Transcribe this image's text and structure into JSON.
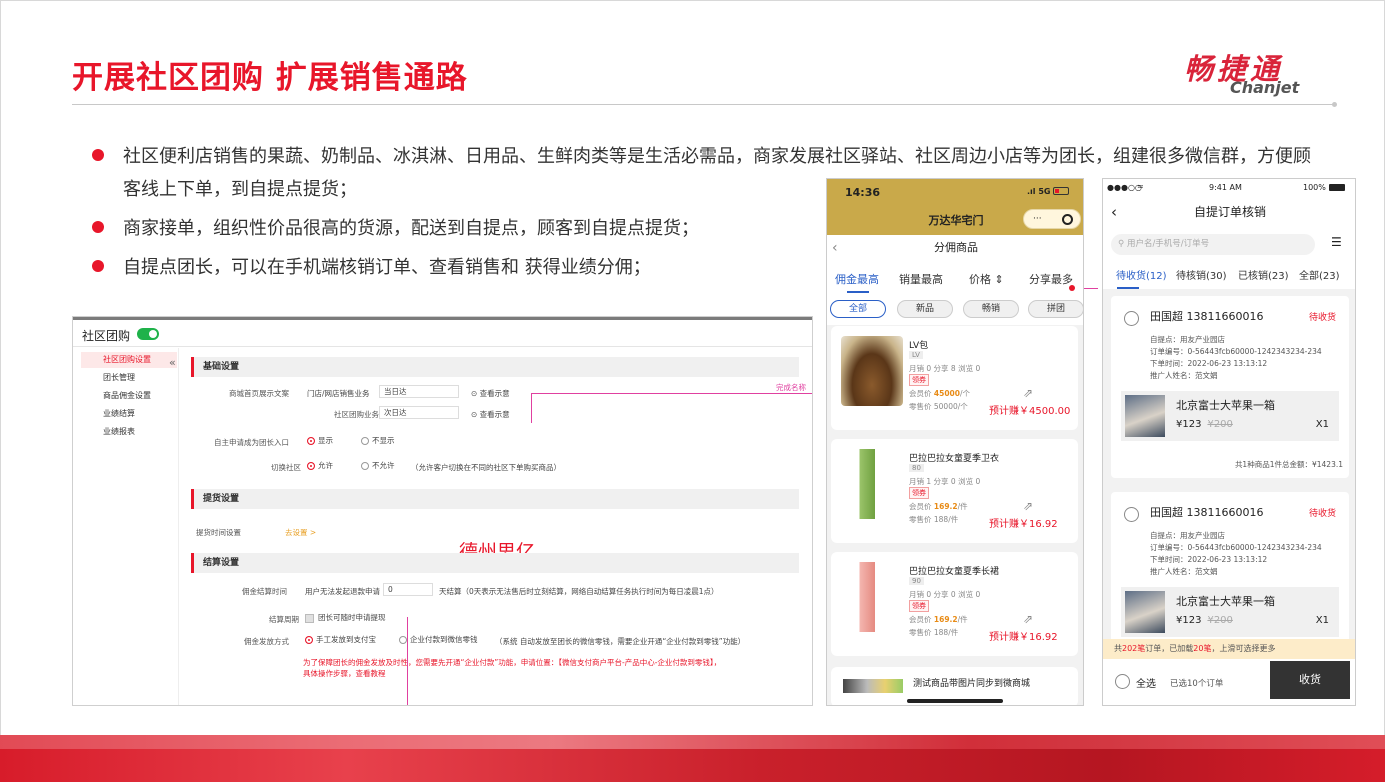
{
  "slide": {
    "title": "开展社区团购 扩展销售通路",
    "logo_cn": "畅捷通",
    "logo_en": "Chanjet",
    "bullets": [
      "社区便利店销售的果蔬、奶制品、冰淇淋、日用品、生鲜肉类等是生活必需品，商家发展社区驿站、社区周边小店等为团长，组建很多微信群，方便顾客线上下单，到自提点提货；",
      "商家接单，组织性价品很高的货源，配送到自提点，顾客到自提点提货；",
      "自提点团长，可以在手机端核销订单、查看销售和 获得业绩分佣；"
    ]
  },
  "admin": {
    "title": "社区团购",
    "sidebar": [
      "社区团购设置",
      "团长管理",
      "商品佣金设置",
      "业绩结算",
      "业绩报表"
    ],
    "collapse_icon": "«",
    "sections": {
      "basic": "基础设置",
      "pickup": "提货设置",
      "settle": "结算设置"
    },
    "basic": {
      "store_copy_label": "商城首页展示文案",
      "store_copy_left": "门店/网店销售业务",
      "store_copy_value": "当日达",
      "example": "查看示意",
      "community_label": "社区团购业务",
      "community_value": "次日达",
      "apply_label": "自主申请成为团长入口",
      "apply_yes": "显示",
      "apply_no": "不显示",
      "switch_label": "切换社区",
      "switch_yes": "允许",
      "switch_no": "不允许",
      "switch_note": "（允许客户切换在不同的社区下单购买商品）",
      "pink_note": "完成名称"
    },
    "pickup": {
      "time_label": "提货时间设置",
      "time_link": "去设置 >"
    },
    "settle": {
      "time_label": "佣金结算时间",
      "time_prefix": "用户无法发起退款申请",
      "time_value": "0",
      "time_suffix": "天结算（0天表示无法售后时立刻结算，网络自动结算任务执行时间为每日凌晨1点）",
      "period_label": "结算周期",
      "period_value": "团长可随时申请提现",
      "method_label": "佣金发放方式",
      "method_manual": "手工发放到支付宝",
      "method_auto": "企业付款到微信零钱",
      "method_note": "（系统 自动发放至团长的微信零钱，需要企业开通“企业付款到零钱”功能）",
      "red_note_1": "为了保障团长的佣金发放及时性，您需要先开通“企业付款”功能，申请位置：【微信支付商户平台-产品中心-企业付款到零钱】，",
      "red_note_2": "具体操作步骤，查看教程"
    },
    "watermark": "德州思亿"
  },
  "phone1": {
    "time": "14:36",
    "signal": "5G",
    "store_name": "万达华宅门",
    "caps_dots": "···",
    "nav_title": "分佣商品",
    "tabs": [
      "佣金最高",
      "销量最高",
      "价格 ⇕",
      "分享最多"
    ],
    "chips": [
      "全部",
      "新品",
      "畅销",
      "拼团"
    ],
    "products": [
      {
        "name": "LV包",
        "tag": "LV",
        "meta": "月销 0 分享 8 浏览 0",
        "badge": "领券",
        "member_label": "会员价",
        "member_price": "45000",
        "member_unit": "/个",
        "retail": "零售价 50000/个",
        "earn": "预计赚￥4500.00"
      },
      {
        "name": "巴拉巴拉女童夏季卫衣",
        "tag": "80",
        "meta": "月销 1 分享 0 浏览 0",
        "badge": "领券",
        "member_label": "会员价",
        "member_price": "169.2",
        "member_unit": "/件",
        "retail": "零售价 188/件",
        "earn": "预计赚￥16.92"
      },
      {
        "name": "巴拉巴拉女童夏季长裙",
        "tag": "90",
        "meta": "月销 0 分享 0 浏览 0",
        "badge": "领券",
        "member_label": "会员价",
        "member_price": "169.2",
        "member_unit": "/件",
        "retail": "零售价 188/件",
        "earn": "预计赚￥16.92"
      }
    ],
    "last_item": "测试商品带图片同步到微商城"
  },
  "phone2": {
    "carrier": "●●●○○",
    "wifi": "≈",
    "time": "9:41 AM",
    "battery": "100%",
    "nav_title": "自提订单核销",
    "search_placeholder": "用户名/手机号/订单号",
    "tabs": [
      "待收货(12)",
      "待核销(30)",
      "已核销(23)",
      "全部(23)"
    ],
    "orders": [
      {
        "customer": "田国超 13811660016",
        "status": "待收货",
        "pickup": "自提点：用友产业园店",
        "order_no": "订单编号：0-56443fcb60000-1242343234-234",
        "time": "下单时间：2022-06-23 13:13:12",
        "promoter": "推广人姓名：范文娟",
        "product": "北京富士大苹果一箱",
        "price": "¥123",
        "orig": "¥200",
        "qty": "X1",
        "total": "共1种商品1件总金额：¥1423.1"
      },
      {
        "customer": "田国超 13811660016",
        "status": "待收货",
        "pickup": "自提点：用友产业园店",
        "order_no": "订单编号：0-56443fcb60000-1242343234-234",
        "time": "下单时间：2022-06-23 13:13:12",
        "promoter": "推广人姓名：范文娟",
        "product": "北京富士大苹果一箱",
        "price": "¥123",
        "orig": "¥200",
        "qty": "X1"
      }
    ],
    "notice_prefix": "共",
    "notice_count1": "202笔",
    "notice_mid": "订单，已加载",
    "notice_count2": "20笔",
    "notice_suffix": "，上滑可选择更多",
    "select_all": "全选",
    "selected": "已选10个订单",
    "receive_button": "收货"
  }
}
